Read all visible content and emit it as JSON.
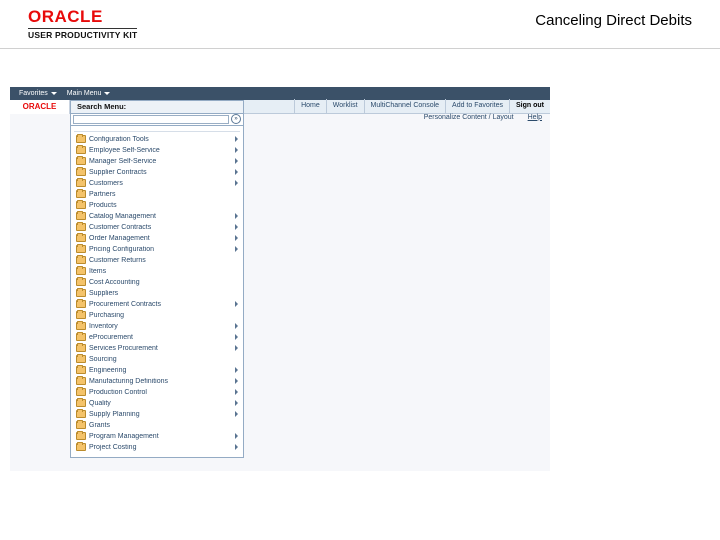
{
  "doc_title": "Canceling Direct Debits",
  "logo": {
    "brand": "ORACLE",
    "product": "USER PRODUCTIVITY KIT"
  },
  "topbar": {
    "favorites": "Favorites",
    "main_menu": "Main Menu"
  },
  "sub_logo": "ORACLE",
  "menu_head": {
    "search_label": "Search Menu:"
  },
  "toolbar": {
    "home": "Home",
    "worklist": "Worklist",
    "multichannel": "MultiChannel Console",
    "add_favorites": "Add to Favorites",
    "sign_out": "Sign out"
  },
  "personalize": {
    "label": "Personalize Content / Layout",
    "help": "Help"
  },
  "menu": {
    "items": [
      {
        "label": "Configuration Tools",
        "submenu": true
      },
      {
        "label": "Employee Self-Service",
        "submenu": true
      },
      {
        "label": "Manager Self-Service",
        "submenu": true
      },
      {
        "label": "Supplier Contracts",
        "submenu": true
      },
      {
        "label": "Customers",
        "submenu": true
      },
      {
        "label": "Partners",
        "submenu": false
      },
      {
        "label": "Products",
        "submenu": false
      },
      {
        "label": "Catalog Management",
        "submenu": true
      },
      {
        "label": "Customer Contracts",
        "submenu": true
      },
      {
        "label": "Order Management",
        "submenu": true
      },
      {
        "label": "Pricing Configuration",
        "submenu": true
      },
      {
        "label": "Customer Returns",
        "submenu": false
      },
      {
        "label": "Items",
        "submenu": false
      },
      {
        "label": "Cost Accounting",
        "submenu": false
      },
      {
        "label": "Suppliers",
        "submenu": false
      },
      {
        "label": "Procurement Contracts",
        "submenu": true
      },
      {
        "label": "Purchasing",
        "submenu": false
      },
      {
        "label": "Inventory",
        "submenu": true
      },
      {
        "label": "eProcurement",
        "submenu": true
      },
      {
        "label": "Services Procurement",
        "submenu": true
      },
      {
        "label": "Sourcing",
        "submenu": false
      },
      {
        "label": "Engineering",
        "submenu": true
      },
      {
        "label": "Manufacturing Definitions",
        "submenu": true
      },
      {
        "label": "Production Control",
        "submenu": true
      },
      {
        "label": "Quality",
        "submenu": true
      },
      {
        "label": "Supply Planning",
        "submenu": true
      },
      {
        "label": "Grants",
        "submenu": false
      },
      {
        "label": "Program Management",
        "submenu": true
      },
      {
        "label": "Project Costing",
        "submenu": true
      }
    ]
  }
}
